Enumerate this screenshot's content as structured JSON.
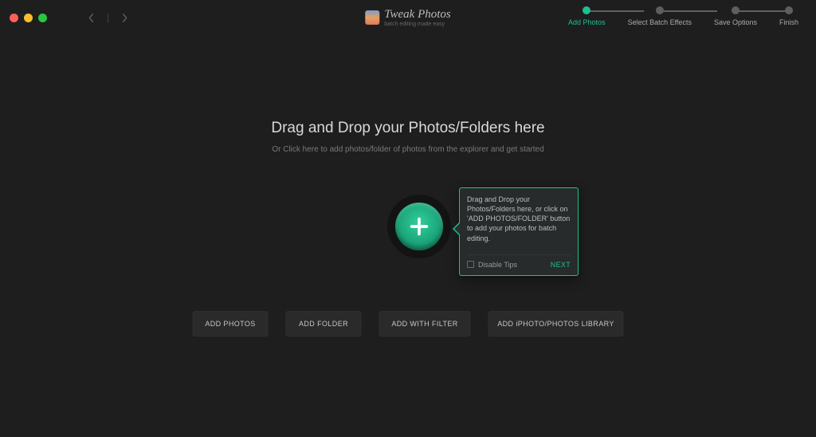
{
  "app": {
    "name": "Tweak Photos",
    "tagline": "batch editing made easy"
  },
  "stepper": {
    "steps": [
      {
        "label": "Add Photos",
        "active": true
      },
      {
        "label": "Select Batch Effects",
        "active": false
      },
      {
        "label": "Save Options",
        "active": false
      },
      {
        "label": "Finish",
        "active": false
      }
    ]
  },
  "drop": {
    "heading": "Drag and Drop your Photos/Folders here",
    "sub": "Or Click here to add photos/folder of photos from the explorer and get started"
  },
  "tip": {
    "text": "Drag and Drop your Photos/Folders here, or click on 'ADD PHOTOS/FOLDER' button to add your photos for batch editing.",
    "disable_label": "Disable Tips",
    "next_label": "NEXT"
  },
  "buttons": {
    "add_photos": "ADD PHOTOS",
    "add_folder": "ADD FOLDER",
    "add_with_filter": "ADD WITH FILTER",
    "add_library": "ADD iPHOTO/PHOTOS LIBRARY"
  }
}
